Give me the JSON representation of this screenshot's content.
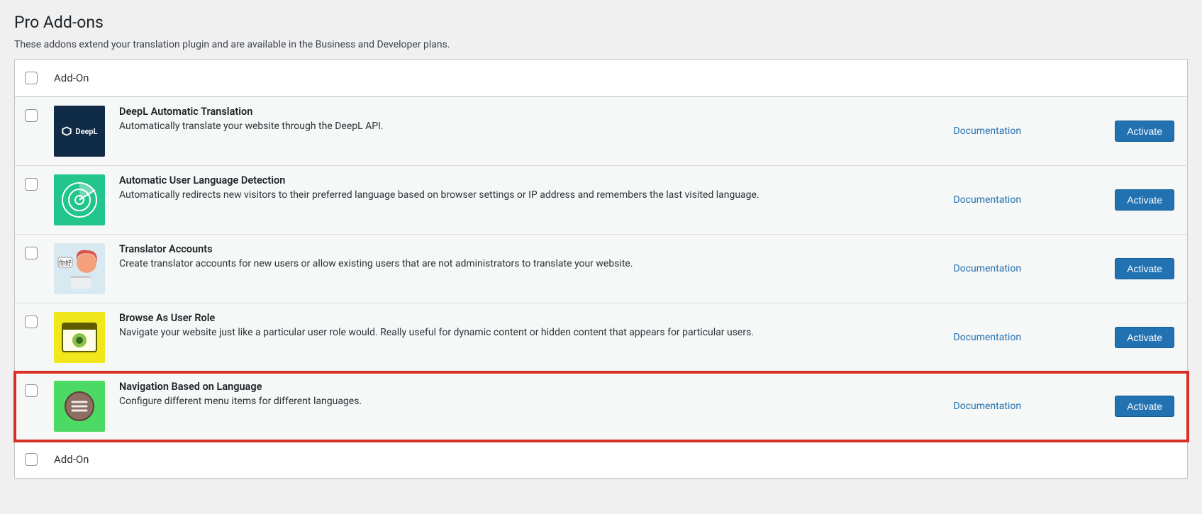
{
  "page": {
    "title": "Pro Add-ons",
    "subtitle": "These addons extend your translation plugin and are available in the Business and Developer plans."
  },
  "columns": {
    "addon": "Add-On"
  },
  "labels": {
    "documentation": "Documentation",
    "activate": "Activate"
  },
  "addons": [
    {
      "title": "DeepL Automatic Translation",
      "description": "Automatically translate your website through the DeepL API.",
      "icon": "deepl"
    },
    {
      "title": "Automatic User Language Detection",
      "description": "Automatically redirects new visitors to their preferred language based on browser settings or IP address and remembers the last visited language.",
      "icon": "radar"
    },
    {
      "title": "Translator Accounts",
      "description": "Create translator accounts for new users or allow existing users that are not administrators to translate your website.",
      "icon": "translator"
    },
    {
      "title": "Browse As User Role",
      "description": "Navigate your website just like a particular user role would. Really useful for dynamic content or hidden content that appears for particular users.",
      "icon": "browse"
    },
    {
      "title": "Navigation Based on Language",
      "description": "Configure different menu items for different languages.",
      "icon": "nav",
      "highlighted": true
    }
  ]
}
